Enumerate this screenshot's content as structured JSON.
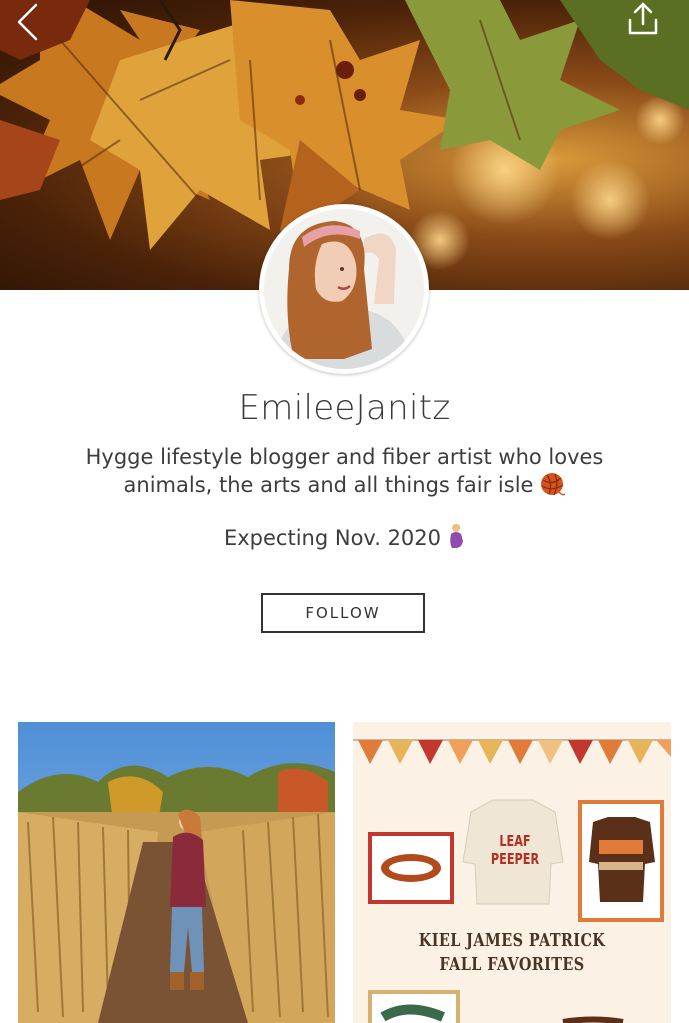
{
  "profile": {
    "username": "EmileeJanitz",
    "bio_line1": "Hygge lifestyle blogger and fiber artist who loves",
    "bio_line2": "animals, the arts and all things fair isle",
    "expecting": "Expecting Nov. 2020"
  },
  "actions": {
    "follow_label": "FOLLOW"
  },
  "icons": {
    "back": "chevron-left-icon",
    "share": "share-upload-icon",
    "yarn": "yarn-ball-emoji",
    "pregnant": "pregnant-woman-emoji"
  },
  "posts": [
    {
      "kind": "photo",
      "subject": "woman in corn maze"
    },
    {
      "kind": "graphic",
      "title_line1": "KIEL JAMES PATRICK",
      "title_line2": "FALL FAVORITES",
      "sweater_text": "LEAF PEEPER"
    }
  ],
  "colors": {
    "text": "#3d3d3d",
    "button_border": "#333333",
    "background": "#ffffff"
  }
}
